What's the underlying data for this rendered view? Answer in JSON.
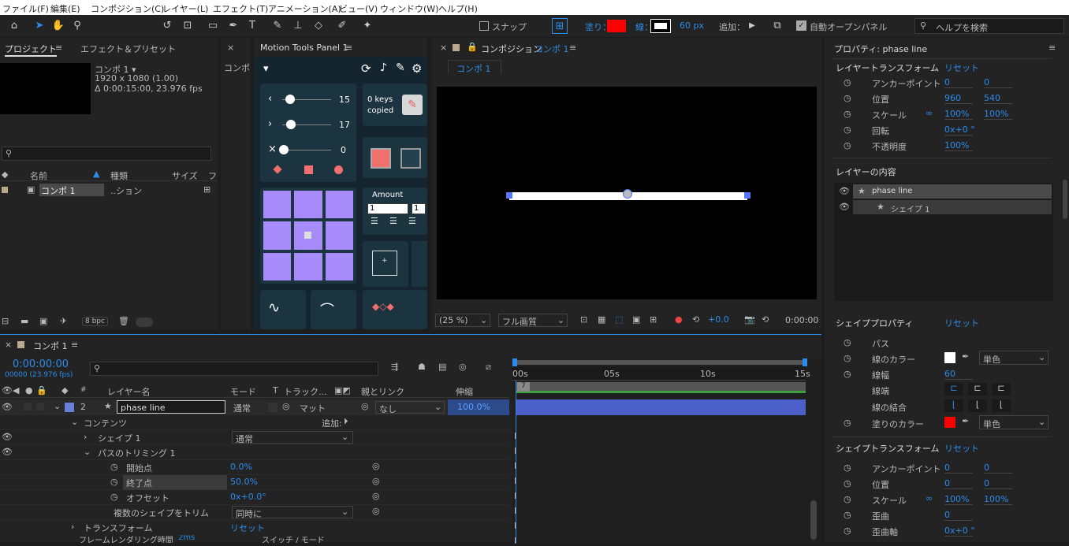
{
  "menu": [
    "ファイル(F)",
    "編集(E)",
    "コンポジション(C)",
    "レイヤー(L)",
    "エフェクト(T)",
    "アニメーション(A)",
    "ビュー(V)",
    "ウィンドウ(W)",
    "ヘルプ(H)"
  ],
  "toolbar": {
    "snap": "スナップ",
    "fill": "塗り：",
    "stroke": "線：",
    "stroke_px": "60 px",
    "add": "追加：",
    "auto_open": "自動オープンパネル",
    "help_search": "ヘルプを検索",
    "fill_color": "#ff0000"
  },
  "project": {
    "tab_project": "プロジェクト",
    "tab_effects": "エフェクト＆プリセット",
    "comp_name": "コンポ 1 ▾",
    "resolution": "1920 x 1080 (1.00)",
    "duration": "Δ 0:00:15:00, 23.976 fps",
    "col_name": "名前",
    "col_type": "種類",
    "col_size": "サイズ",
    "col_f": "フ",
    "item_name": "コンポ 1",
    "item_type": "..ション",
    "bpc": "8 bpc"
  },
  "side": {
    "label": "コンポ"
  },
  "motion": {
    "title": "Motion Tools Panel 1",
    "v1": "15",
    "v2": "17",
    "v3": "0",
    "keys_copied": "0 keys copied",
    "amount": "Amount",
    "amount_v1": "1",
    "amount_v2": "1"
  },
  "comp": {
    "tab_label": "コンポジション",
    "comp_link": "コンポ 1",
    "sub_tab": "コンポ 1",
    "zoom": "(25 %)",
    "quality": "フル画質",
    "exposure": "+0.0",
    "timecode": "0:00:00"
  },
  "props": {
    "title": "プロパティ: phase line",
    "layer_transform": "レイヤートランスフォーム",
    "reset": "リセット",
    "anchor": "アンカーポイント",
    "position": "位置",
    "scale": "スケール",
    "rotation": "回転",
    "opacity": "不透明度",
    "anchor_x": "0",
    "anchor_y": "0",
    "pos_x": "960",
    "pos_y": "540",
    "scale_x": "100%",
    "scale_y": "100%",
    "rot": "0x+0 °",
    "opacity_v": "100%",
    "layer_contents": "レイヤーの内容",
    "item_layer": "phase line",
    "item_shape": "シェイプ 1",
    "shape_props": "シェイププロパティ",
    "path": "パス",
    "stroke_color": "線のカラー",
    "stroke_width": "線幅",
    "stroke_width_v": "60",
    "line_cap": "線端",
    "line_join": "線の結合",
    "fill_color": "塗りのカラー",
    "solid": "単色",
    "shape_transform": "シェイプトランスフォーム",
    "sanchor_x": "0",
    "sanchor_y": "0",
    "spos_x": "0",
    "spos_y": "0",
    "sscale_x": "100%",
    "sscale_y": "100%",
    "skew": "歪曲",
    "skew_v": "0",
    "skew_axis": "歪曲軸",
    "skew_axis_v": "0x+0 °"
  },
  "timeline": {
    "tab": "コンポ 1",
    "timecode": "0:00:00:00",
    "frames": "00000 (23.976 fps)",
    "col_num": "#",
    "col_layer": "レイヤー名",
    "col_mode": "モード",
    "col_t": "T",
    "col_track": "トラック...",
    "col_parent": "親とリンク",
    "col_stretch": "伸縮",
    "layer_num": "2",
    "layer_name": "phase line",
    "layer_mode": "通常",
    "layer_matte": "マット",
    "parent_none": "なし",
    "stretch": "100.0%",
    "contents": "コンテンツ",
    "add": "追加:",
    "shape1": "シェイプ 1",
    "shape1_mode": "通常",
    "trim": "パスのトリミング 1",
    "start": "開始点",
    "start_v": "0.0%",
    "end": "終了点",
    "end_v": "50.0%",
    "offset": "オフセット",
    "offset_v": "0x+0.0°",
    "trim_multi": "複数のシェイプをトリム",
    "trim_multi_v": "同時に",
    "transform": "トランスフォーム",
    "transform_reset": "リセット",
    "render_time": "フレームレンダリング時間",
    "render_ms": "2ms",
    "switch_mode": "スイッチ / モード",
    "ruler": [
      "00s",
      "05s",
      "10s",
      "15s"
    ]
  }
}
